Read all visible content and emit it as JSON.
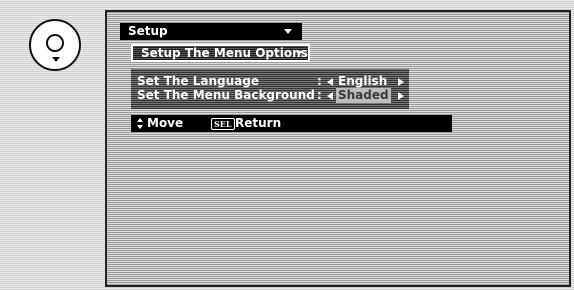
{
  "menu": {
    "title": "Setup",
    "submenu_title": "Setup The Menu Options",
    "options": [
      {
        "label": "Set The Language",
        "separator": ":",
        "value": "English"
      },
      {
        "label": "Set The Menu Background",
        "separator": ":",
        "value": "Shaded"
      }
    ]
  },
  "nav": {
    "move_label": "Move",
    "sel_key_label": "SEL",
    "return_label": "Return"
  },
  "icons": {
    "remote": "remote-dial-icon",
    "updown": "up-down-arrows-icon",
    "sel": "sel-key-icon"
  }
}
